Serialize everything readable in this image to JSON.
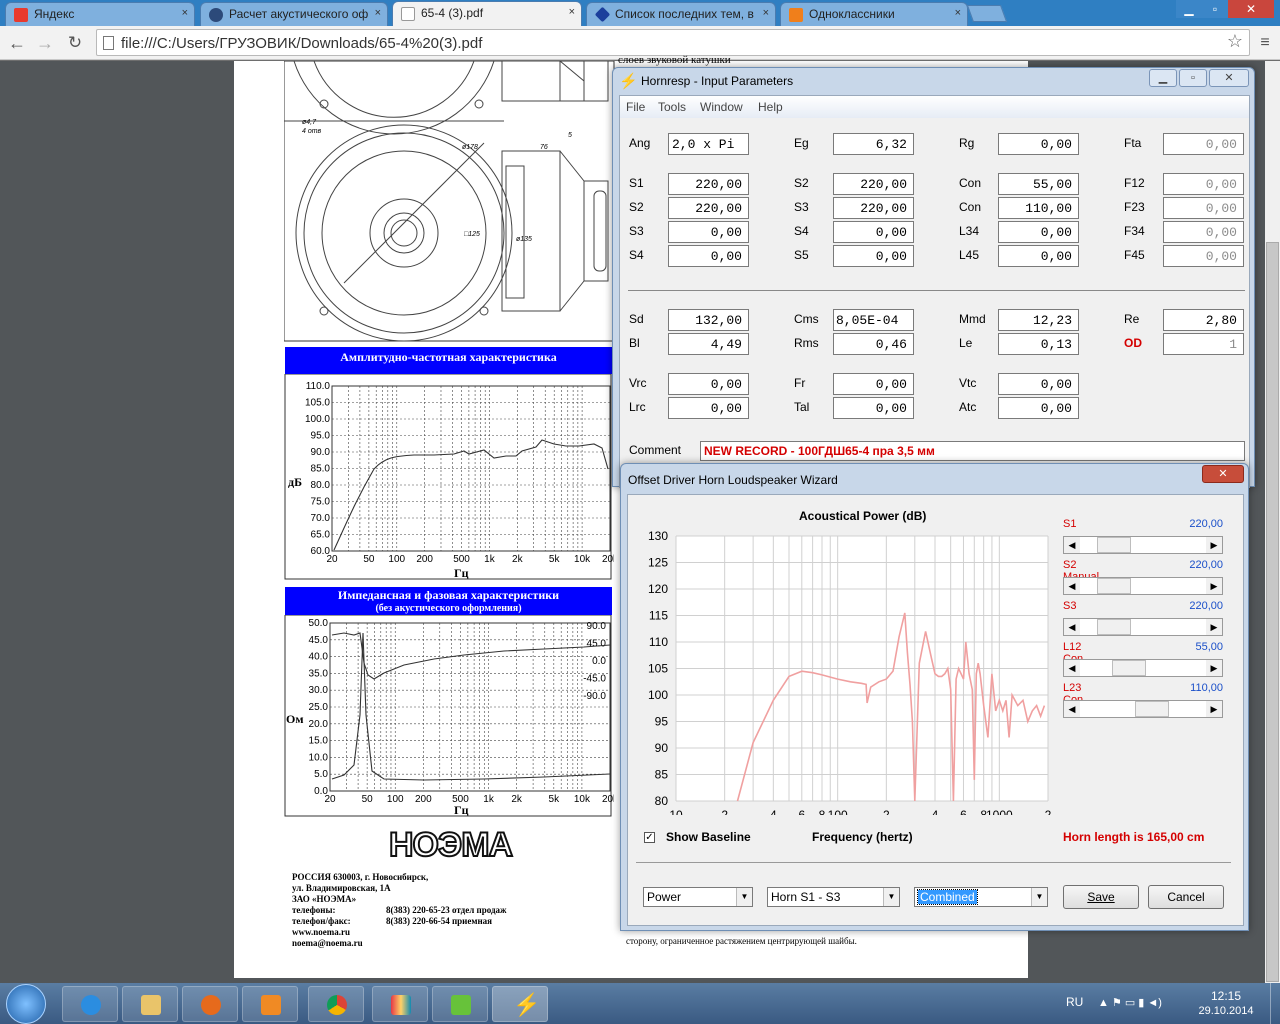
{
  "browser": {
    "tabs": [
      {
        "label": "Яндекс",
        "favicon_color": "#e83a2e"
      },
      {
        "label": "Расчет акустического оф",
        "favicon_color": "#2c4a7a"
      },
      {
        "label": "65-4 (3).pdf",
        "favicon_color": "#ffffff"
      },
      {
        "label": "Список последних тем, в",
        "favicon_color": "#1c3f9c"
      },
      {
        "label": "Одноклассники",
        "favicon_color": "#f07f1b"
      }
    ],
    "address": "file:///C:/Users/ГРУЗОВИК/Downloads/65-4%20(3).pdf",
    "close_glyph": "×"
  },
  "pdf": {
    "top_text": "слоев звуковой катушки",
    "dims": {
      "d47": "ø4,7",
      "count": "4 отв",
      "d178": "ø178",
      "d76": "76",
      "d5": "5",
      "d125": "□125",
      "d135": "ø135"
    },
    "freq_chart": {
      "title": "Амплитудно-частотная характеристика",
      "ylabel": "дБ",
      "xlabel": "Гц",
      "yticks": [
        "110.0",
        "105.0",
        "100.0",
        "95.0",
        "90.0",
        "85.0",
        "80.0",
        "75.0",
        "70.0",
        "65.0",
        "60.0"
      ],
      "xticks": [
        "20",
        "50",
        "100",
        "200",
        "500",
        "1k",
        "2k",
        "5k",
        "10k",
        "20k"
      ]
    },
    "imp_chart": {
      "title": "Импедансная и фазовая характеристики",
      "subtitle": "(без акустического оформления)",
      "ylabel": "Ом",
      "xlabel": "Гц",
      "yticks": [
        "50.0",
        "45.0",
        "40.0",
        "35.0",
        "30.0",
        "25.0",
        "20.0",
        "15.0",
        "10.0",
        "5.0",
        "0.0"
      ],
      "phase_ticks": [
        "90.0",
        "45.0",
        "0.0",
        "-45.0",
        "-90.0"
      ],
      "xticks": [
        "20",
        "50",
        "100",
        "200",
        "500",
        "1k",
        "2k",
        "5k",
        "10k",
        "20k"
      ]
    },
    "logo": "НОЭМА",
    "address_lines": [
      "РОССИЯ  630003, г. Новосибирск,",
      "ул. Владимировская, 1А",
      "ЗАО «НОЭМА»",
      "телефоны:",
      "телефон/факс:",
      "www.noema.ru",
      "noema@noema.ru"
    ],
    "phones": [
      "8(383) 220-65-23  отдел  продаж",
      "8(383) 220-66-54  приемная"
    ],
    "bottom_text": [
      "сторону, ограниченное растяжением центрирующей шайбы."
    ]
  },
  "hornresp": {
    "title": "Hornresp - Input Parameters",
    "menu": [
      "File",
      "Tools",
      "Window",
      "Help"
    ],
    "fields": [
      {
        "label": "Ang",
        "value": "2,0 x Pi"
      },
      {
        "label": "Eg",
        "value": "6,32"
      },
      {
        "label": "Rg",
        "value": "0,00"
      },
      {
        "label": "Fta",
        "value": "0,00"
      },
      {
        "label": "S1",
        "value": "220,00"
      },
      {
        "label": "S2",
        "value": "220,00"
      },
      {
        "label": "Con",
        "value": "55,00"
      },
      {
        "label": "F12",
        "value": "0,00"
      },
      {
        "label": "S2",
        "value": "220,00"
      },
      {
        "label": "S3",
        "value": "220,00"
      },
      {
        "label": "Con",
        "value": "110,00"
      },
      {
        "label": "F23",
        "value": "0,00"
      },
      {
        "label": "S3",
        "value": "0,00"
      },
      {
        "label": "S4",
        "value": "0,00"
      },
      {
        "label": "L34",
        "value": "0,00"
      },
      {
        "label": "F34",
        "value": "0,00"
      },
      {
        "label": "S4",
        "value": "0,00"
      },
      {
        "label": "S5",
        "value": "0,00"
      },
      {
        "label": "L45",
        "value": "0,00"
      },
      {
        "label": "F45",
        "value": "0,00"
      },
      {
        "label": "Sd",
        "value": "132,00"
      },
      {
        "label": "Cms",
        "value": "8,05E-04"
      },
      {
        "label": "Mmd",
        "value": "12,23"
      },
      {
        "label": "Re",
        "value": "2,80"
      },
      {
        "label": "Bl",
        "value": "4,49"
      },
      {
        "label": "Rms",
        "value": "0,46"
      },
      {
        "label": "Le",
        "value": "0,13"
      },
      {
        "label": "OD",
        "value": "1"
      },
      {
        "label": "Vrc",
        "value": "0,00"
      },
      {
        "label": "Fr",
        "value": "0,00"
      },
      {
        "label": "Vtc",
        "value": "0,00"
      },
      {
        "label": "Lrc",
        "value": "0,00"
      },
      {
        "label": "Tal",
        "value": "0,00"
      },
      {
        "label": "Atc",
        "value": "0,00"
      }
    ],
    "comment_label": "Comment",
    "comment": "NEW RECORD - 100ГДШ65-4 пра 3,5 мм"
  },
  "wizard": {
    "title": "Offset Driver Horn Loudspeaker Wizard",
    "sliders": [
      {
        "label": "S1",
        "value": "220,00",
        "position": 0.18
      },
      {
        "label": "S2  Manual",
        "value": "220,00",
        "position": 0.18
      },
      {
        "label": "S3",
        "value": "220,00",
        "position": 0.18
      },
      {
        "label": "L12  Con",
        "value": "55,00",
        "position": 0.35
      },
      {
        "label": "L23  Con",
        "value": "110,00",
        "position": 0.6
      }
    ],
    "show_baseline": "Show Baseline",
    "xlabel_text": "Frequency (hertz)",
    "horn_length": "Horn length is 165,00 cm",
    "combos": [
      "Power",
      "Horn S1 - S3",
      "Combined"
    ],
    "save": "Save",
    "cancel": "Cancel"
  },
  "chart_data": {
    "type": "line",
    "title": "Acoustical Power (dB)",
    "xlabel": "Frequency (hertz)",
    "ylabel": "",
    "xscale": "log",
    "xlim": [
      10,
      2000
    ],
    "ylim": [
      80,
      130
    ],
    "yticks": [
      "130",
      "125",
      "120",
      "115",
      "110",
      "105",
      "100",
      "95",
      "90",
      "85",
      "80"
    ],
    "xticks": [
      "10",
      "2",
      "4",
      "6",
      "8",
      "100",
      "2",
      "4",
      "6",
      "8",
      "1000",
      "2"
    ],
    "series": [
      {
        "color": "#f0a0a0",
        "x": [
          24,
          30,
          40,
          50,
          60,
          70,
          80,
          100,
          120,
          140,
          150,
          152,
          160,
          180,
          200,
          220,
          240,
          260,
          270,
          280,
          290,
          300,
          320,
          350,
          380,
          400,
          420,
          440,
          460,
          480,
          500,
          520,
          540,
          560,
          580,
          600,
          620,
          650,
          680,
          700,
          720,
          740,
          760,
          800,
          850,
          900,
          950,
          1000,
          1050,
          1100,
          1150,
          1200,
          1300,
          1400,
          1500,
          1600,
          1700,
          1800,
          1900
        ],
        "y": [
          80,
          91,
          99,
          103.5,
          104.5,
          104.2,
          103.8,
          103,
          102.5,
          102.2,
          102,
          98.5,
          101.5,
          102.5,
          103,
          104.5,
          111,
          115.5,
          108,
          102,
          95,
          80,
          106,
          112,
          107,
          104,
          103.5,
          103.5,
          104,
          105,
          101,
          80,
          103,
          105,
          104,
          103,
          110,
          104,
          101,
          84,
          104,
          106,
          104,
          98,
          92,
          104,
          97,
          99,
          97,
          99,
          92,
          100,
          98,
          99,
          95,
          97,
          98,
          96,
          98
        ]
      }
    ]
  },
  "taskbar": {
    "lang": "RU",
    "time": "12:15",
    "date": "29.10.2014"
  }
}
